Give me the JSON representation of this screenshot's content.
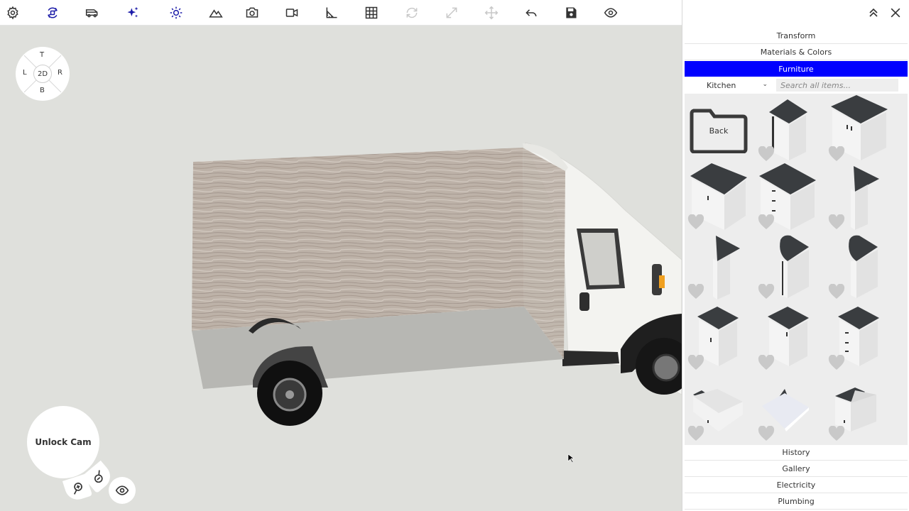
{
  "orientation": {
    "top": "T",
    "left": "L",
    "right": "R",
    "bottom": "B",
    "center": "2D"
  },
  "camera": {
    "unlock_label": "Unlock Cam"
  },
  "panel": {
    "sections_top": [
      "Transform",
      "Materials & Colors",
      "Furniture"
    ],
    "active_section": "Furniture",
    "category_selected": "Kitchen",
    "search_placeholder": "Search all items...",
    "back_label": "Back",
    "sections_bottom": [
      "History",
      "Gallery",
      "Electricity",
      "Plumbing"
    ]
  },
  "colors": {
    "accent": "#0000ff",
    "viewport_bg": "#dfe0dc",
    "icon_active": "#1a1aa8"
  },
  "icons": {
    "toolbar": [
      "gear-icon",
      "rotate-object-icon",
      "van-icon",
      "sparkles-icon",
      "sun-icon",
      "terrain-icon",
      "camera-icon",
      "video-icon",
      "ruler-angle-icon",
      "grid-icon",
      "refresh-icon",
      "expand-icon",
      "move-icon",
      "undo-icon",
      "save-icon",
      "eye-icon"
    ],
    "panel": [
      "collapse-up-icon",
      "close-icon"
    ]
  }
}
